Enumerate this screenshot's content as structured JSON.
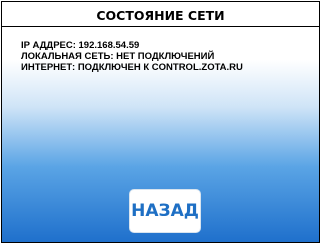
{
  "header": {
    "title": "СОСТОЯНИЕ СЕТИ"
  },
  "status": {
    "ip_line": "IP АДДРЕС: 192.168.54.59",
    "lan_line": "ЛОКАЛЬНАЯ СЕТЬ: НЕТ ПОДКЛЮЧЕНИЙ",
    "internet_line": "ИНТЕРНЕТ: ПОДКЛЮЧЕН К CONTROL.ZOTA.RU"
  },
  "actions": {
    "back_label": "НАЗАД"
  },
  "colors": {
    "background_gradient_bottom": "#1f70cc",
    "button_text": "#1e6fc4"
  }
}
